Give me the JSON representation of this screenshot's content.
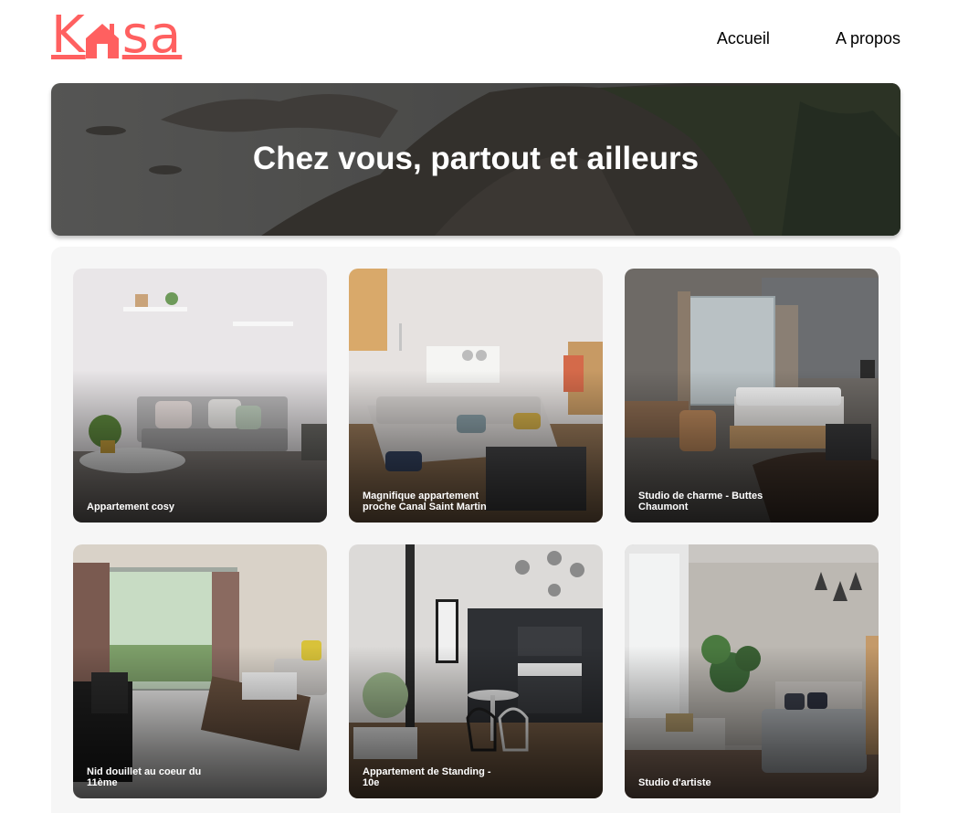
{
  "brand": {
    "logo_text_left": "K",
    "logo_text_right": "sa",
    "color": "#ff6060"
  },
  "nav": {
    "items": [
      {
        "label": "Accueil"
      },
      {
        "label": "A propos"
      }
    ]
  },
  "banner": {
    "title": "Chez vous, partout et ailleurs"
  },
  "listings": [
    {
      "title": "Appartement cosy"
    },
    {
      "title": "Magnifique appartement proche Canal Saint Martin"
    },
    {
      "title": "Studio de charme - Buttes Chaumont"
    },
    {
      "title": "Nid douillet au coeur du 11ème"
    },
    {
      "title": "Appartement de Standing - 10e"
    },
    {
      "title": "Studio d'artiste"
    }
  ]
}
